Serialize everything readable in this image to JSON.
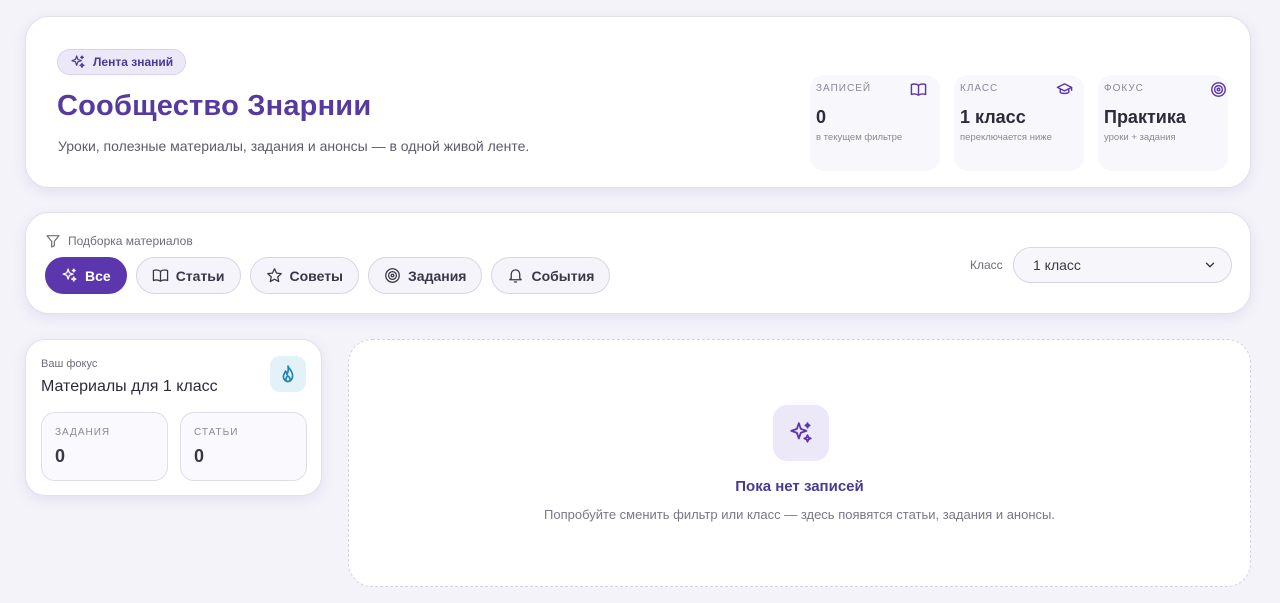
{
  "header": {
    "badge_label": "Лента знаний",
    "title": "Сообщество Знарнии",
    "subtitle": "Уроки, полезные материалы, задания и анонсы — в одной живой ленте."
  },
  "stats": [
    {
      "label": "ЗАПИСЕЙ",
      "icon": "book-icon",
      "value": "0",
      "note": "в текущем фильтре"
    },
    {
      "label": "КЛАСС",
      "icon": "graduation-cap-icon",
      "value": "1 класс",
      "note": "переключается ниже"
    },
    {
      "label": "ФОКУС",
      "icon": "target-icon",
      "value": "Практика",
      "note": "уроки + задания"
    }
  ],
  "filter": {
    "title": "Подборка материалов",
    "chips": [
      {
        "label": "Все",
        "icon": "sparkles-icon",
        "active": true
      },
      {
        "label": "Статьи",
        "icon": "book-icon",
        "active": false
      },
      {
        "label": "Советы",
        "icon": "star-icon",
        "active": false
      },
      {
        "label": "Задания",
        "icon": "target-icon",
        "active": false
      },
      {
        "label": "События",
        "icon": "bell-icon",
        "active": false
      }
    ],
    "class_label": "Класс",
    "class_value": "1 класс"
  },
  "focus": {
    "label": "Ваш фокус",
    "title": "Материалы для 1 класс",
    "icon": "flame-icon",
    "tasks_label": "ЗАДАНИЯ",
    "tasks_value": "0",
    "articles_label": "СТАТЬИ",
    "articles_value": "0"
  },
  "empty": {
    "title": "Пока нет записей",
    "subtitle": "Попробуйте сменить фильтр или класс — здесь появятся статьи, задания и анонсы."
  },
  "colors": {
    "accent": "#5b36ad",
    "title": "#563a9f",
    "background": "#f4f3f9"
  }
}
